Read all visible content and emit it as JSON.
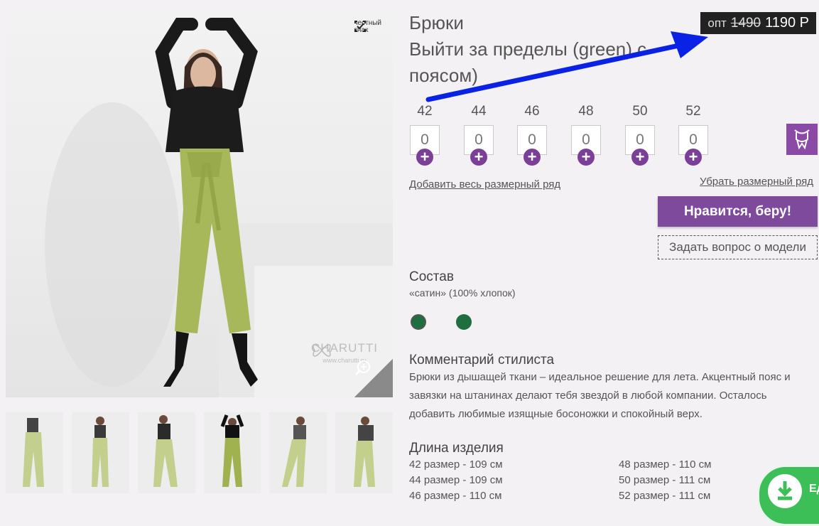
{
  "product": {
    "title_line1": "Брюки",
    "title_line2": "Выйти за пределы (green) с поясом)",
    "price_prefix": "опт",
    "old_price": "1490",
    "new_price": "1190 Р"
  },
  "honest_sign": "честный\nзнак",
  "brand": {
    "name": "CHARUTTI",
    "site": "www.charutti.ru"
  },
  "sizes": [
    {
      "label": "42",
      "qty": "0"
    },
    {
      "label": "44",
      "qty": "0"
    },
    {
      "label": "46",
      "qty": "0"
    },
    {
      "label": "48",
      "qty": "0"
    },
    {
      "label": "50",
      "qty": "0"
    },
    {
      "label": "52",
      "qty": "0"
    }
  ],
  "links": {
    "add_all": "Добавить весь размерный ряд",
    "remove_row": "Убрать размерный ряд"
  },
  "buttons": {
    "buy": "Нравится, беру!",
    "ask": "Задать вопрос о модели"
  },
  "composition": {
    "heading": "Состав",
    "text": "«сатин» (100% хлопок)"
  },
  "colors": {
    "swatch_1": "#1f6e3f",
    "swatch_2": "#1f6e3f",
    "accent": "#7e4b9c",
    "arrow": "#0a22e6"
  },
  "stylist": {
    "heading": "Комментарий стилиста",
    "text": "Брюки из дышащей ткани – идеальное решение для лета. Акцентный пояс и завязки на штанинах делают тебя звездой в любой компании. Осталось добавить любимые изящные босоножки и спокойный верх."
  },
  "length": {
    "heading": "Длина изделия",
    "rows_left": [
      "42 размер - 109 см",
      "44 размер - 109 см",
      "46 размер - 110 см"
    ],
    "rows_right": [
      "48 размер - 110 см",
      "50 размер - 111 см",
      "52 размер - 111 см"
    ]
  },
  "download_label": "Ед"
}
